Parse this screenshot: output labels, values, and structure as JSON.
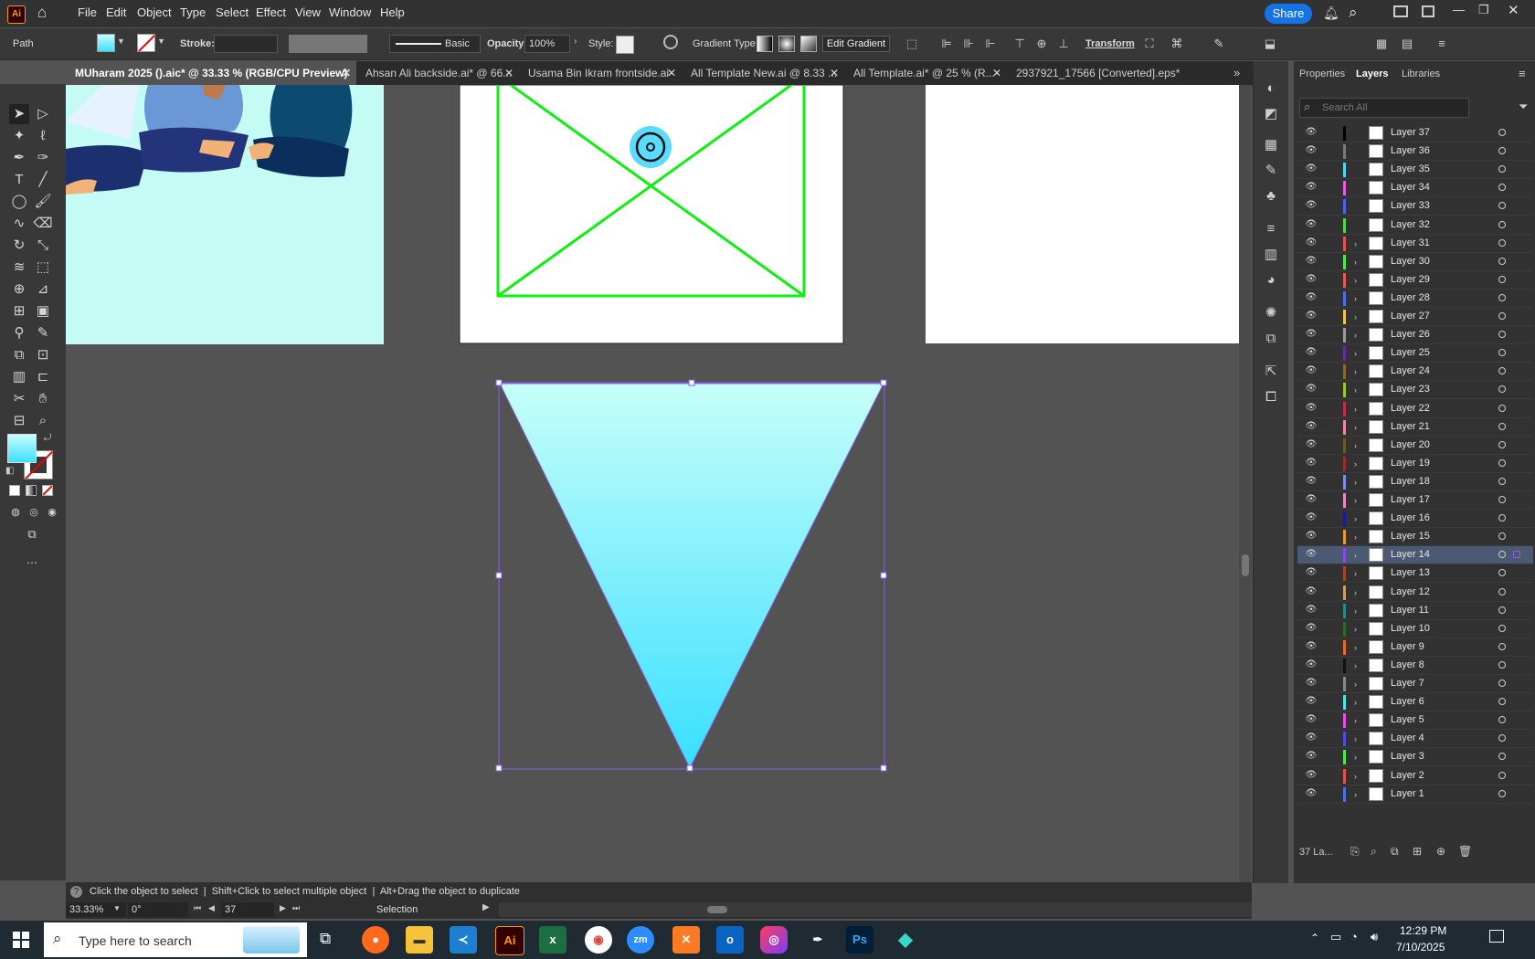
{
  "menubar": {
    "items": [
      "File",
      "Edit",
      "Object",
      "Type",
      "Select",
      "Effect",
      "View",
      "Window",
      "Help"
    ],
    "app_logo": "Ai",
    "share_label": "Share"
  },
  "controlbar": {
    "object_type": "Path",
    "stroke_label": "Stroke:",
    "stroke_profile": "Basic",
    "opacity_label": "Opacity:",
    "opacity_value": "100%",
    "style_label": "Style:",
    "gradient_type_label": "Gradient Type:",
    "edit_gradient_label": "Edit Gradient",
    "transform_label": "Transform",
    "fill_color": "#55e6ff"
  },
  "tabs": [
    {
      "label": "MUharam 2025 ().aic* @ 33.33 % (RGB/CPU Preview)",
      "active": true
    },
    {
      "label": "Ahsan Ali backside.ai* @ 66...",
      "active": false
    },
    {
      "label": "Usama Bin Ikram frontside.ai",
      "active": false
    },
    {
      "label": "All Template New.ai @ 8.33 ...",
      "active": false
    },
    {
      "label": "All Template.ai* @ 25 % (R...",
      "active": false
    },
    {
      "label": "2937921_17566 [Converted].eps*",
      "active": false
    }
  ],
  "panel": {
    "tabs": [
      "Properties",
      "Layers",
      "Libraries"
    ],
    "active_tab": "Layers",
    "search_placeholder": "Search All",
    "footer_count": "37 La...",
    "layers": [
      {
        "name": "Layer 37",
        "color": "#000000",
        "expandable": false
      },
      {
        "name": "Layer 36",
        "color": "#7a7a7a",
        "expandable": false
      },
      {
        "name": "Layer 35",
        "color": "#4fd7ee",
        "expandable": false
      },
      {
        "name": "Layer 34",
        "color": "#e85de8",
        "expandable": false
      },
      {
        "name": "Layer 33",
        "color": "#4f63e8",
        "expandable": false
      },
      {
        "name": "Layer 32",
        "color": "#4fd84f",
        "expandable": false
      },
      {
        "name": "Layer 31",
        "color": "#e84f4f",
        "expandable": true
      },
      {
        "name": "Layer 30",
        "color": "#4fe84f",
        "expandable": true
      },
      {
        "name": "Layer 29",
        "color": "#e85a5a",
        "expandable": true
      },
      {
        "name": "Layer 28",
        "color": "#4f6fe8",
        "expandable": true
      },
      {
        "name": "Layer 27",
        "color": "#e8c84f",
        "expandable": true
      },
      {
        "name": "Layer 26",
        "color": "#9a9a9a",
        "expandable": true
      },
      {
        "name": "Layer 25",
        "color": "#6a2a9a",
        "expandable": true
      },
      {
        "name": "Layer 24",
        "color": "#8a6a2a",
        "expandable": true
      },
      {
        "name": "Layer 23",
        "color": "#9ac82a",
        "expandable": true
      },
      {
        "name": "Layer 22",
        "color": "#c82a4a",
        "expandable": true
      },
      {
        "name": "Layer 21",
        "color": "#e88aa0",
        "expandable": true
      },
      {
        "name": "Layer 20",
        "color": "#6a5a2a",
        "expandable": true
      },
      {
        "name": "Layer 19",
        "color": "#a02a2a",
        "expandable": true
      },
      {
        "name": "Layer 18",
        "color": "#8a8ae8",
        "expandable": true
      },
      {
        "name": "Layer 17",
        "color": "#e88ac8",
        "expandable": true
      },
      {
        "name": "Layer 16",
        "color": "#1a1a9a",
        "expandable": true
      },
      {
        "name": "Layer 15",
        "color": "#e89a2a",
        "expandable": true
      },
      {
        "name": "Layer 14",
        "color": "#8a4ae8",
        "expandable": true,
        "selected": true
      },
      {
        "name": "Layer 13",
        "color": "#a04a2a",
        "expandable": true
      },
      {
        "name": "Layer 12",
        "color": "#c8a06a",
        "expandable": true
      },
      {
        "name": "Layer 11",
        "color": "#2a8a8a",
        "expandable": true
      },
      {
        "name": "Layer 10",
        "color": "#2a6a2a",
        "expandable": true
      },
      {
        "name": "Layer 9",
        "color": "#e86a2a",
        "expandable": true
      },
      {
        "name": "Layer 8",
        "color": "#111111",
        "expandable": true
      },
      {
        "name": "Layer 7",
        "color": "#8a8a8a",
        "expandable": true
      },
      {
        "name": "Layer 6",
        "color": "#4fe8e8",
        "expandable": true
      },
      {
        "name": "Layer 5",
        "color": "#e84fe8",
        "expandable": true
      },
      {
        "name": "Layer 4",
        "color": "#4f4fe8",
        "expandable": true
      },
      {
        "name": "Layer 3",
        "color": "#4fe84f",
        "expandable": true
      },
      {
        "name": "Layer 2",
        "color": "#e84f4f",
        "expandable": true
      },
      {
        "name": "Layer 1",
        "color": "#4f6fe8",
        "expandable": true
      }
    ]
  },
  "status": {
    "hint": "Click the object to select  |  Shift+Click to select multiple object  |  Alt+Drag the object to duplicate",
    "zoom": "33.33%",
    "rotation": "0°",
    "artboard": "37",
    "tool": "Selection"
  },
  "taskbar": {
    "search_placeholder": "Type here to search",
    "time": "12:29 PM",
    "date": "7/10/2025"
  }
}
